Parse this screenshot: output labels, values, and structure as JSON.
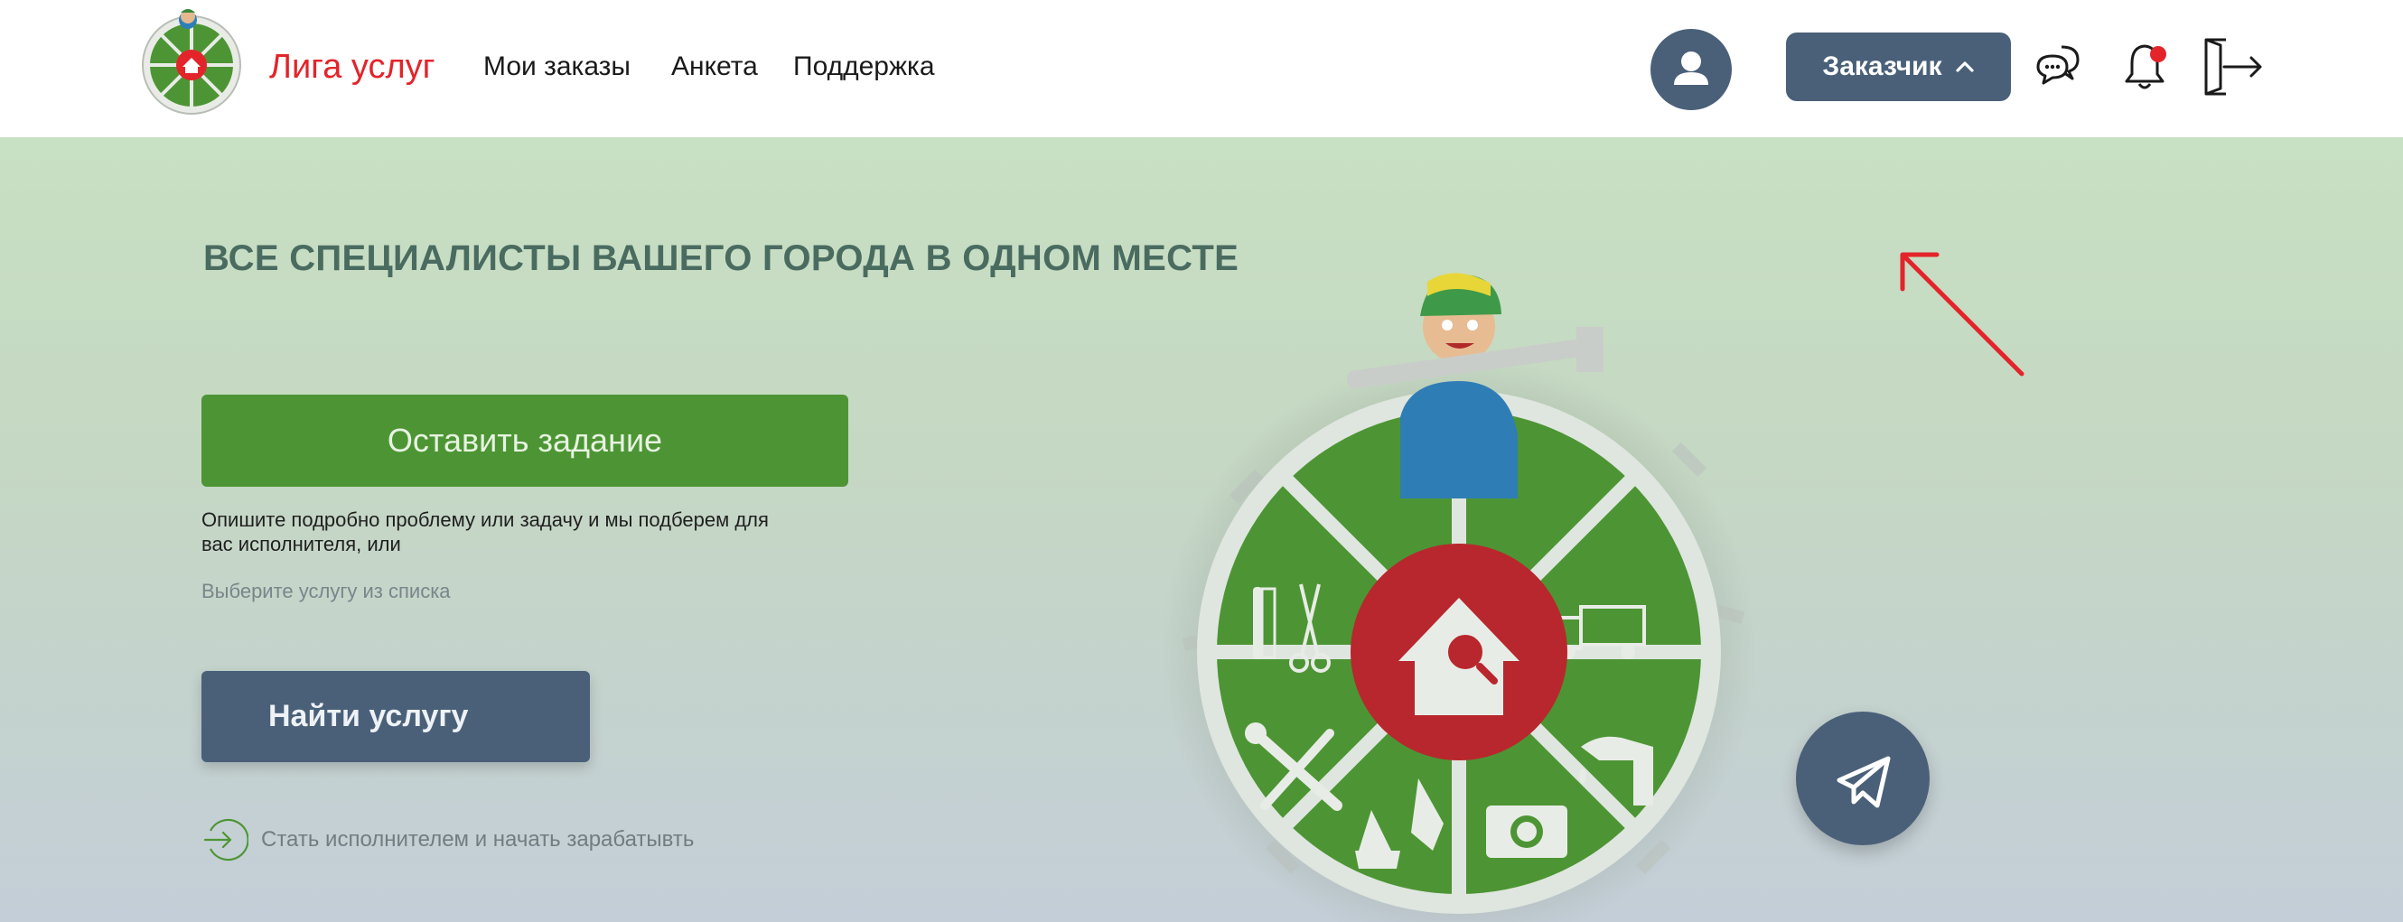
{
  "header": {
    "brand": "Лига услуг",
    "nav": [
      "Мои заказы",
      "Анкета",
      "Поддержка"
    ],
    "role_button": "Заказчик",
    "icons": [
      "user-icon",
      "chat-icon",
      "bell-icon",
      "logout-icon"
    ],
    "notification_dot_color": "#e3242b"
  },
  "hero": {
    "headline": "ВСЕ СПЕЦИАЛИСТЫ ВАШЕГО ГОРОДА В ОДНОМ МЕСТЕ",
    "primary_button": "Оставить задание",
    "description": "Опишите подробно проблему или задачу и мы подберем для вас исполнителя, или",
    "pick_link": "Выберите услугу из списка",
    "find_button": "Найти услугу",
    "join_link": "Стать исполнителем и начать зарабатывть"
  },
  "colors": {
    "brand_red": "#e3242b",
    "green": "#4d9534",
    "slate": "#4a6079"
  }
}
